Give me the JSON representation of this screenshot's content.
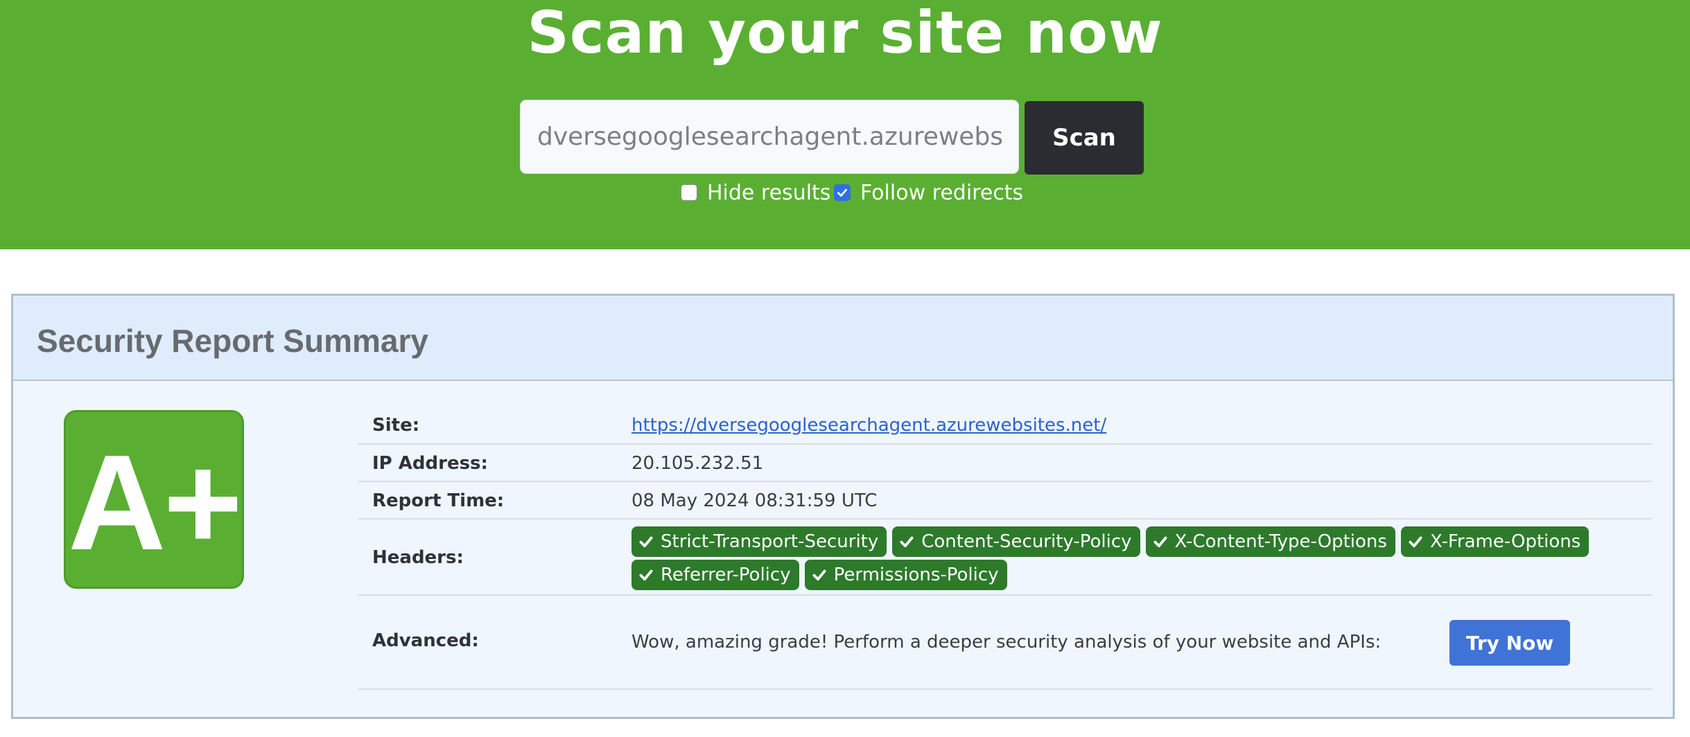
{
  "hero": {
    "title": "Scan your site now",
    "input_value": "dversegooglesearchagent.azurewebsites.net",
    "scan_label": "Scan",
    "hide_results_label": "Hide results",
    "hide_results_checked": false,
    "follow_redirects_label": "Follow redirects",
    "follow_redirects_checked": true
  },
  "report": {
    "title": "Security Report Summary",
    "grade": "A+",
    "site_label": "Site:",
    "site_url": "https://dversegooglesearchagent.azurewebsites.net/",
    "ip_label": "IP Address:",
    "ip_value": "20.105.232.51",
    "time_label": "Report Time:",
    "time_value": "08 May 2024 08:31:59 UTC",
    "headers_label": "Headers:",
    "headers": [
      "Strict-Transport-Security",
      "Content-Security-Policy",
      "X-Content-Type-Options",
      "X-Frame-Options",
      "Referrer-Policy",
      "Permissions-Policy"
    ],
    "advanced_label": "Advanced:",
    "advanced_text": "Wow, amazing grade! Perform a deeper security analysis of your website and APIs:",
    "try_label": "Try Now"
  },
  "colors": {
    "hero_green": "#5aaf32",
    "badge_green": "#2d7a2b",
    "try_blue": "#3f73d6",
    "scan_dark": "#2b2c31"
  },
  "icons": {
    "badge_icon": "check-icon"
  }
}
